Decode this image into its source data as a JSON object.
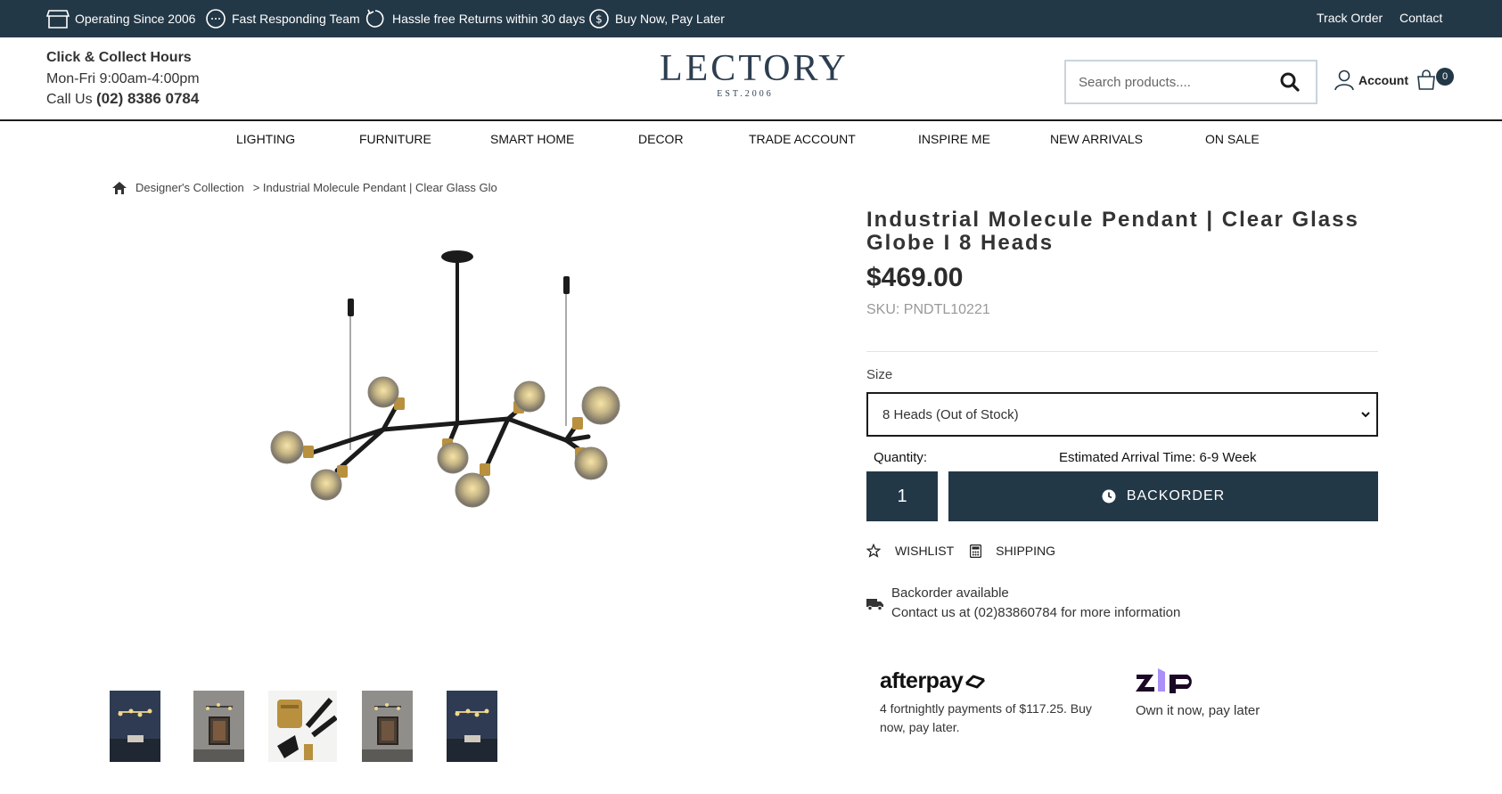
{
  "topbar": {
    "features": [
      {
        "icon": "store-icon",
        "label": "Operating Since 2006"
      },
      {
        "icon": "chat-icon",
        "label": "Fast Responding Team"
      },
      {
        "icon": "return-icon",
        "label": "Hassle free Returns within 30 days"
      },
      {
        "icon": "dollar-icon",
        "label": "Buy Now, Pay Later"
      }
    ],
    "track_order": "Track Order",
    "contact": "Contact"
  },
  "header": {
    "collect_title": "Click & Collect Hours",
    "collect_hours": "Mon-Fri 9:00am-4:00pm",
    "call_prefix": "Call Us",
    "phone": "(02) 8386 0784",
    "logo_name": "LECTORY",
    "logo_est": "EST.2006",
    "search_placeholder": "Search products....",
    "account_label": "Account",
    "cart_count": "0"
  },
  "nav": [
    "LIGHTING",
    "FURNITURE",
    "SMART HOME",
    "DECOR",
    "TRADE ACCOUNT",
    "INSPIRE ME",
    "NEW ARRIVALS",
    "ON SALE"
  ],
  "breadcrumb": {
    "collection": "Designer's Collection",
    "current": "> Industrial Molecule Pendant | Clear Glass Glo"
  },
  "product": {
    "title": "Industrial Molecule Pendant | Clear Glass Globe I 8 Heads",
    "price": "$469.00",
    "sku": "SKU: PNDTL10221",
    "size_label": "Size",
    "size_selected": "8 Heads (Out of Stock)",
    "quantity_label": "Quantity:",
    "eta": "Estimated Arrival Time: 6-9 Week",
    "quantity": "1",
    "backorder_button": "BACKORDER",
    "wishlist": "WISHLIST",
    "shipping": "SHIPPING",
    "availability": "Backorder available",
    "contact_info": "Contact us at (02)83860784 for more information"
  },
  "payments": {
    "afterpay_brand": "afterpay",
    "afterpay_text": "4 fortnightly payments of $117.25. Buy now, pay later.",
    "zip_brand": "zip",
    "zip_text": "Own it now, pay later"
  },
  "colors": {
    "dark_navy": "#233847",
    "zip_purple": "#aa8ff7"
  }
}
